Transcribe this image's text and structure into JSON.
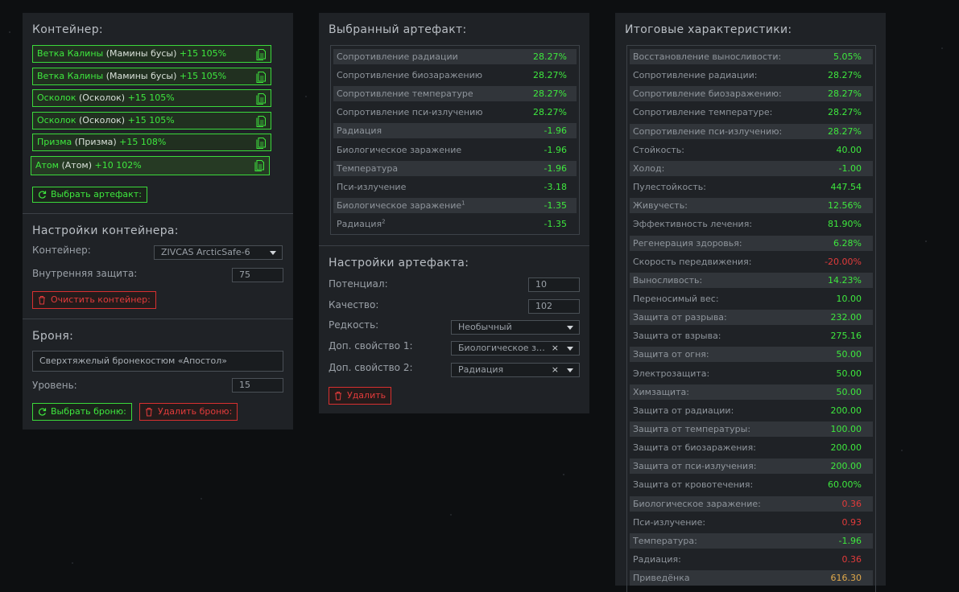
{
  "container": {
    "title": "Контейнер:",
    "slots": [
      {
        "name": "Ветка Калины",
        "base": "(Мамины бусы)",
        "bonus": "+15 105%"
      },
      {
        "name": "Ветка Калины",
        "base": "(Мамины бусы)",
        "bonus": "+15 105%"
      },
      {
        "name": "Осколок",
        "base": "(Осколок)",
        "bonus": "+15 105%"
      },
      {
        "name": "Осколок",
        "base": "(Осколок)",
        "bonus": "+15 105%"
      },
      {
        "name": "Призма",
        "base": "(Призма)",
        "bonus": "+15 108%"
      },
      {
        "name": "Атом",
        "base": "(Атом)",
        "bonus": "+10 102%"
      }
    ],
    "select_artifact_label": "Выбрать артефакт:"
  },
  "container_settings": {
    "title": "Настройки контейнера:",
    "container_label": "Контейнер:",
    "container_value": "ZIVCAS ArcticSafe-6",
    "inner_protection_label": "Внутренняя защита:",
    "inner_protection_value": "75",
    "clear_label": "Очистить контейнер:"
  },
  "armor": {
    "title": "Броня:",
    "armor_value": "Сверхтяжелый бронекостюм «Апостол»",
    "level_label": "Уровень:",
    "level_value": "15",
    "select_label": "Выбрать броню:",
    "remove_label": "Удалить броню:"
  },
  "selected_artifact": {
    "title": "Выбранный артефакт:",
    "stats": [
      {
        "name": "Сопротивление радиации",
        "value": "28.27%",
        "color": "green"
      },
      {
        "name": "Сопротивление биозаражению",
        "value": "28.27%",
        "color": "green"
      },
      {
        "name": "Сопротивление температуре",
        "value": "28.27%",
        "color": "green"
      },
      {
        "name": "Сопротивление пси-излучению",
        "value": "28.27%",
        "color": "green"
      },
      {
        "name": "Радиация",
        "value": "-1.96",
        "color": "green"
      },
      {
        "name": "Биологическое заражение",
        "value": "-1.96",
        "color": "green"
      },
      {
        "name": "Температура",
        "value": "-1.96",
        "color": "green"
      },
      {
        "name": "Пси-излучение",
        "value": "-3.18",
        "color": "green"
      },
      {
        "name": "Биологическое заражение",
        "sup": "1",
        "value": "-1.35",
        "color": "green"
      },
      {
        "name": "Радиация",
        "sup": "2",
        "value": "-1.35",
        "color": "green"
      }
    ]
  },
  "artifact_settings": {
    "title": "Настройки артефакта:",
    "potential_label": "Потенциал:",
    "potential_value": "10",
    "quality_label": "Качество:",
    "quality_value": "102",
    "rarity_label": "Редкость:",
    "rarity_value": "Необычный",
    "extra1_label": "Доп. свойство 1:",
    "extra1_value": "Биологическое заражение",
    "extra2_label": "Доп. свойство 2:",
    "extra2_value": "Радиация",
    "delete_label": "Удалить"
  },
  "summary": {
    "title": "Итоговые характеристики:",
    "stats": [
      {
        "name": "Восстановление выносливости:",
        "value": "5.05%",
        "color": "green"
      },
      {
        "name": "Сопротивление радиации:",
        "value": "28.27%",
        "color": "green"
      },
      {
        "name": "Сопротивление биозаражению:",
        "value": "28.27%",
        "color": "green"
      },
      {
        "name": "Сопротивление температуре:",
        "value": "28.27%",
        "color": "green"
      },
      {
        "name": "Сопротивление пси-излучению:",
        "value": "28.27%",
        "color": "green"
      },
      {
        "name": "Стойкость:",
        "value": "40.00",
        "color": "green"
      },
      {
        "name": "Холод:",
        "value": "-1.00",
        "color": "green"
      },
      {
        "name": "Пулестойкость:",
        "value": "447.54",
        "color": "green"
      },
      {
        "name": "Живучесть:",
        "value": "12.56%",
        "color": "green"
      },
      {
        "name": "Эффективность лечения:",
        "value": "81.90%",
        "color": "green"
      },
      {
        "name": "Регенерация здоровья:",
        "value": "6.28%",
        "color": "green"
      },
      {
        "name": "Скорость передвижения:",
        "value": "-20.00%",
        "color": "red"
      },
      {
        "name": "Выносливость:",
        "value": "14.23%",
        "color": "green"
      },
      {
        "name": "Переносимый вес:",
        "value": "10.00",
        "color": "green"
      },
      {
        "name": "Защита от разрыва:",
        "value": "232.00",
        "color": "green"
      },
      {
        "name": "Защита от взрыва:",
        "value": "275.16",
        "color": "green"
      },
      {
        "name": "Защита от огня:",
        "value": "50.00",
        "color": "green"
      },
      {
        "name": "Электрозащита:",
        "value": "50.00",
        "color": "green"
      },
      {
        "name": "Химзащита:",
        "value": "50.00",
        "color": "green"
      },
      {
        "name": "Защита от радиации:",
        "value": "200.00",
        "color": "green"
      },
      {
        "name": "Защита от температуры:",
        "value": "100.00",
        "color": "green"
      },
      {
        "name": "Защита от биозаражения:",
        "value": "200.00",
        "color": "green"
      },
      {
        "name": "Защита от пси-излучения:",
        "value": "200.00",
        "color": "green"
      },
      {
        "name": "Защита от кровотечения:",
        "value": "60.00%",
        "color": "green"
      },
      {
        "name": "Биологическое заражение:",
        "value": "0.36",
        "color": "red"
      },
      {
        "name": "Пси-излучение:",
        "value": "0.93",
        "color": "red"
      },
      {
        "name": "Температура:",
        "value": "-1.96",
        "color": "green"
      },
      {
        "name": "Радиация:",
        "value": "0.36",
        "color": "red"
      },
      {
        "name": "Приведёнка",
        "value": "616.30",
        "color": "orange"
      }
    ]
  }
}
